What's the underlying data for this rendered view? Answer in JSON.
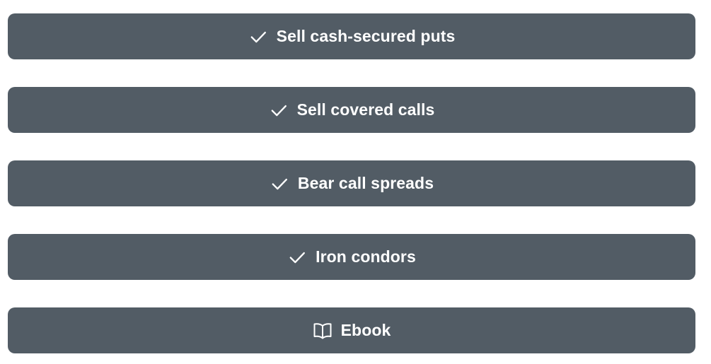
{
  "colors": {
    "button_bg": "#525c65",
    "text": "#ffffff",
    "page_bg": "#ffffff"
  },
  "items": [
    {
      "label": "Sell cash-secured puts",
      "icon": "check-icon"
    },
    {
      "label": "Sell covered calls",
      "icon": "check-icon"
    },
    {
      "label": "Bear call spreads",
      "icon": "check-icon"
    },
    {
      "label": "Iron condors",
      "icon": "check-icon"
    },
    {
      "label": "Ebook",
      "icon": "open-book-icon"
    }
  ]
}
